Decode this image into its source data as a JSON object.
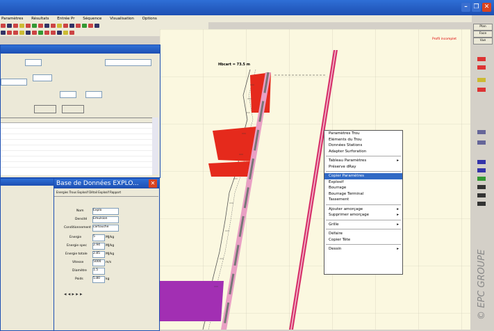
{
  "app": {
    "menu": [
      "Paramètres",
      "Résultats",
      "Entrée Pr",
      "Séquence",
      "Visualisation",
      "Options"
    ]
  },
  "canvas": {
    "hole_label": "Hbcart = 73.5 m",
    "red_note": "Profil incomplet"
  },
  "dialog_back": {
    "title": "Base de Données EXPLO...",
    "tabs": [
      "Energies",
      "Trous Explosif",
      "Détail Explosif",
      "Rapport"
    ],
    "field_labels": [
      "Nom",
      "Densité",
      "Conditionnement",
      "Energie",
      "Energie spec",
      "Energie totale",
      "Vitesse",
      "Diamètre",
      "Poids"
    ],
    "field_values": [
      "Explo",
      "Emulsion",
      "cartouche",
      "5",
      "2.94",
      "2.85",
      "5000",
      "1.5",
      "5.80"
    ],
    "units": [
      "MJ/kg",
      "MJ/kg",
      "MJ/kg",
      "m/s",
      "kg"
    ]
  },
  "context_menu": {
    "items": [
      {
        "label": "Paramètres Trou",
        "sub": false
      },
      {
        "label": "Eléments du Trou",
        "sub": false
      },
      {
        "label": "Données Stations",
        "sub": false
      },
      {
        "label": "Adapter Surforation",
        "sub": false
      },
      {
        "label": "---",
        "sub": false
      },
      {
        "label": "Tableau Paramètres",
        "sub": true
      },
      {
        "label": "Préserve dRay",
        "sub": false
      },
      {
        "label": "---",
        "sub": false
      },
      {
        "label": "Copier Paramètres",
        "sub": false,
        "selected": true
      },
      {
        "label": "Explosif",
        "sub": false
      },
      {
        "label": "Bourrage",
        "sub": false
      },
      {
        "label": "Bourrage Terminal",
        "sub": false
      },
      {
        "label": "Tassement",
        "sub": false
      },
      {
        "label": "---",
        "sub": false
      },
      {
        "label": "Ajouter amorçage",
        "sub": true
      },
      {
        "label": "Supprimer amorçage",
        "sub": true
      },
      {
        "label": "---",
        "sub": false
      },
      {
        "label": "Grille",
        "sub": true
      },
      {
        "label": "---",
        "sub": false
      },
      {
        "label": "Défaire",
        "sub": false
      },
      {
        "label": "Copier Tête",
        "sub": false
      },
      {
        "label": "---",
        "sub": false
      },
      {
        "label": "Dessin",
        "sub": true
      }
    ]
  },
  "right_panel": {
    "buttons": [
      "Plan",
      "Face",
      "Vue"
    ]
  },
  "watermark": "© EPC GROUPE"
}
